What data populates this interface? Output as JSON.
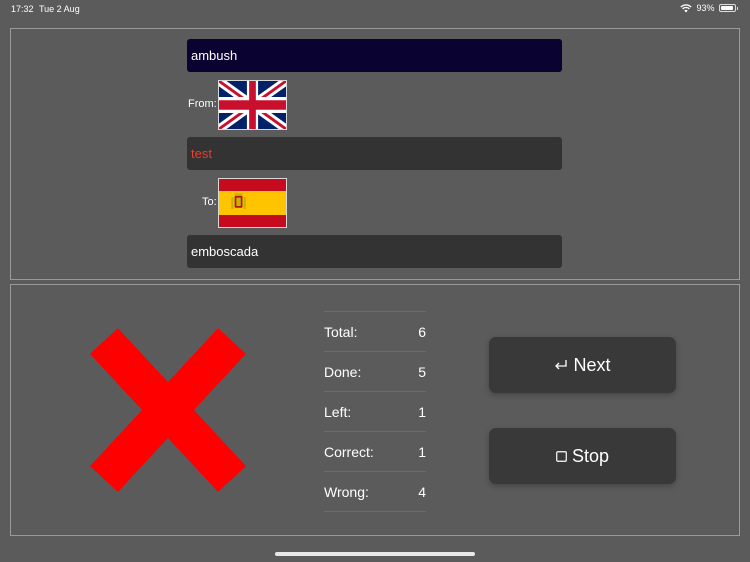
{
  "status": {
    "time": "17:32",
    "date": "Tue 2 Aug",
    "battery": "93%",
    "battery_level": 0.93
  },
  "quiz": {
    "word": "ambush",
    "from_label": "From:",
    "from_flag": "uk-flag-icon",
    "test_value": "test",
    "to_label": "To:",
    "to_flag": "spain-flag-icon",
    "answer": "emboscada",
    "result_icon": "red-x-icon"
  },
  "stats": [
    {
      "label": "Total:",
      "value": "6"
    },
    {
      "label": "Done:",
      "value": "5"
    },
    {
      "label": "Left:",
      "value": "1"
    },
    {
      "label": "Correct:",
      "value": "1"
    },
    {
      "label": "Wrong:",
      "value": "4"
    }
  ],
  "buttons": {
    "next_label": "Next",
    "next_icon": "return-icon",
    "stop_label": "Stop",
    "stop_icon": "square-icon"
  },
  "colors": {
    "word_bg": "#0a0231",
    "wrong_text": "#e83d32",
    "x_mark": "#ff0000"
  }
}
